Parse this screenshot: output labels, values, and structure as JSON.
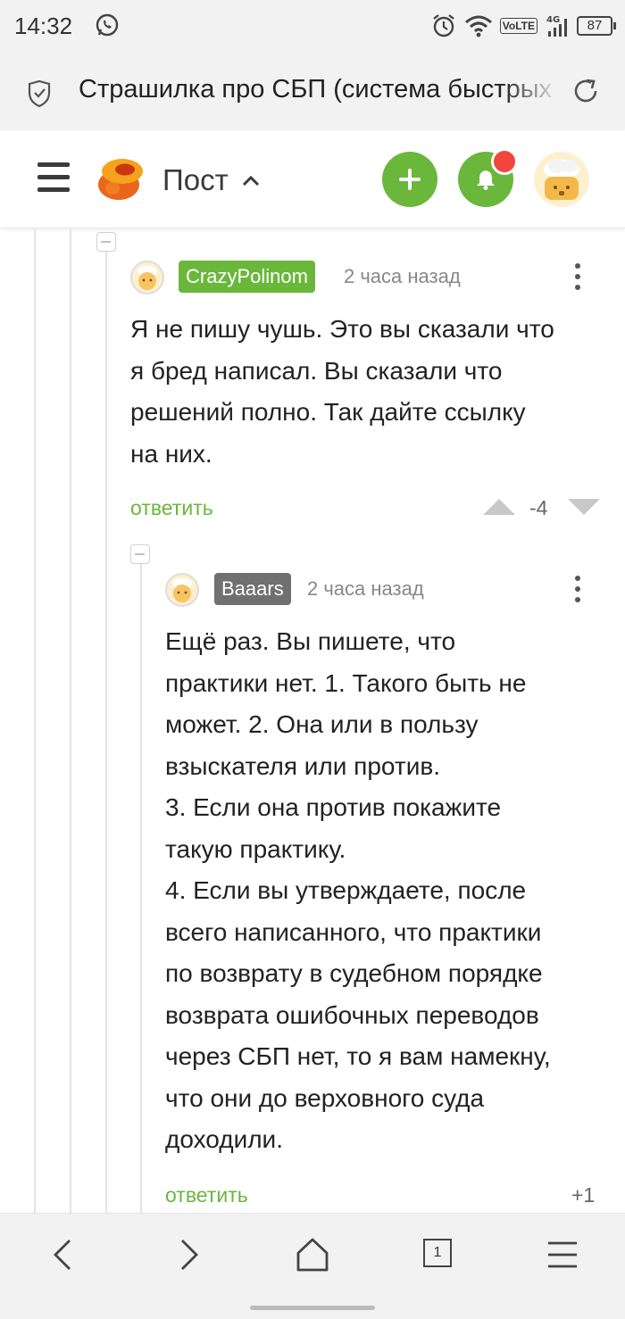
{
  "status_bar": {
    "time": "14:32",
    "network": "4G",
    "volte": "VoLTE",
    "battery": "87",
    "icons": [
      "whatsapp-icon",
      "alarm-icon",
      "wifi-icon",
      "signal-icon",
      "battery-icon"
    ]
  },
  "browser": {
    "page_title": "Страшилка про СБП (система быстрых платежей)",
    "icons": [
      "shield-icon",
      "reload-icon"
    ]
  },
  "app_header": {
    "section_title": "Пост",
    "icons": [
      "menu-icon",
      "pikabu-logo-icon",
      "chevron-up-icon",
      "plus-icon",
      "bell-icon"
    ],
    "colors": {
      "accent": "#6ab73b",
      "notification": "#f2453d"
    }
  },
  "comments": [
    {
      "username": "CrazyPolinom",
      "username_color": "#6ab73b",
      "time": "2 часа назад",
      "text": "Я не пишу чушь. Это вы сказали что\nя бред написал. Вы сказали что\nрешений полно. Так дайте ссылку\nна них.",
      "reply_label": "ответить",
      "score": "-4"
    },
    {
      "username": "Baaars",
      "username_color": "#707070",
      "time": "2 часа назад",
      "text": "Ещё раз. Вы пишете, что\nпрактики нет. 1. Такого быть не\nможет. 2. Она или в пользу\nвзыскателя или против.\n3. Если она против покажите\nтакую практику.\n4. Если вы утверждаете, после\nвсего написанного, что практики\nпо возврату в судебном порядке\nвозврата ошибочных переводов\nчерез СБП нет, то я вам намекну,\nчто они до верховного суда\nдоходили.",
      "reply_label": "ответить",
      "score": "+1"
    }
  ],
  "bottom_nav": {
    "tab_count": "1",
    "icons": [
      "back-icon",
      "forward-icon",
      "home-icon",
      "tabs-icon",
      "menu-icon"
    ]
  }
}
